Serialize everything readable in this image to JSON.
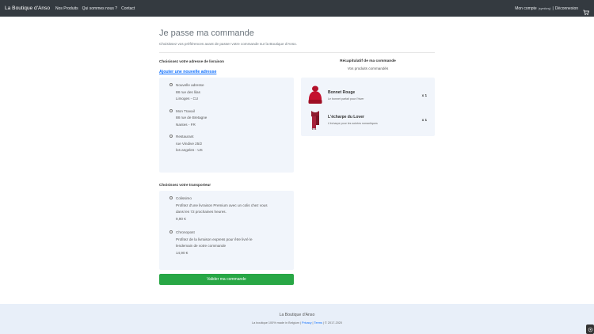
{
  "nav": {
    "brand": "La Boutique d'Anso",
    "links": [
      "Nos Produits",
      "Qui sommes nous ?",
      "Contact"
    ],
    "account": "Mon compte",
    "account_user": "(symfony)",
    "separator": "|",
    "logout": "Déconnexion"
  },
  "page": {
    "title": "Je passe ma commande",
    "subtitle": "Choisissez vos préférences avant de passer votre commande sur la Boutique d'Anso."
  },
  "address": {
    "label": "Choisissez votre adresse de livraison",
    "add_link": "Ajouter une nouvelle adresse",
    "options": [
      {
        "name": "Nouvelle adresse",
        "line1": "88 rue des lilas",
        "line2": "Limoges - CU"
      },
      {
        "name": "Mon Travail",
        "line1": "88 rue de Bretagne",
        "line2": "Nantes - FR"
      },
      {
        "name": "Restaurant",
        "line1": "rue Vindive 25/2",
        "line2": "los angeles - US"
      }
    ]
  },
  "carrier": {
    "label": "Choisissez votre transporteur",
    "options": [
      {
        "name": "Colissimo",
        "desc1": "Profitez d'une livraison Premium avec un colis chez vous",
        "desc2": "dans les 72 prochaines heures.",
        "price": "9,90 €"
      },
      {
        "name": "Chronopost",
        "desc1": "Profitez de la livraison express pour être livré le",
        "desc2": "lendemain de votre commande",
        "price": "14,90 €"
      }
    ]
  },
  "validate_label": "Valider ma commande",
  "recap": {
    "title": "Récapitulatif de ma commande",
    "subtitle": "Vos produits commandés",
    "products": [
      {
        "name": "Bonnet Rouge",
        "desc": "Le bonnet parfait pour l'hiver",
        "qty": "x 1"
      },
      {
        "name": "L'écharpe du Lover",
        "desc": "L'écharpe pour les soirées romantiques",
        "qty": "x 1"
      }
    ]
  },
  "footer": {
    "title": "La Boutique d'Anso",
    "text_prefix": "La boutique 100% made in Belgium",
    "sep": "|",
    "privacy": "Privacy",
    "terms": "Terms",
    "copyright": "© 2017-2020"
  },
  "colors": {
    "navbar": "#343a40",
    "accent": "#0d6efd",
    "validate": "#28a745",
    "panel": "#f1f5fb",
    "footer": "#e8eff9"
  },
  "icons": {
    "cart": "cart-icon",
    "corner": "chat-icon"
  }
}
